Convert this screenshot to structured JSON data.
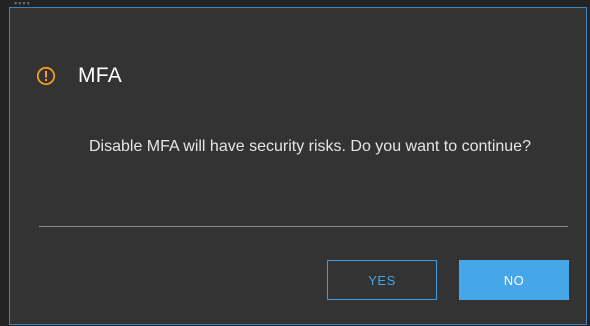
{
  "dialog": {
    "icon": "warning-circle-icon",
    "title": "MFA",
    "message": "Disable MFA will have security risks. Do you want to continue?",
    "buttons": {
      "yes_label": "YES",
      "no_label": "NO"
    }
  },
  "colors": {
    "accent": "#45a6e8",
    "warning": "#f59a23",
    "dialog_bg": "#333333",
    "dialog_border": "#3e82bf"
  }
}
